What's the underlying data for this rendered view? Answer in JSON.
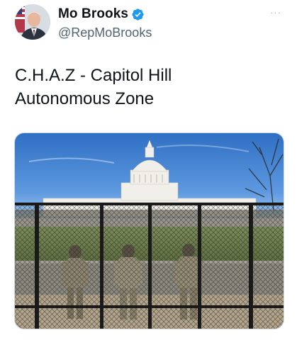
{
  "tweet": {
    "display_name": "Mo Brooks",
    "handle": "@RepMoBrooks",
    "more_label": "···",
    "text_lines": [
      "C.H.A.Z - Capitol Hill",
      "Autonomous Zone"
    ],
    "verified": true
  },
  "colors": {
    "verified_badge": "#1d9bf0",
    "name": "#0f1419",
    "handle": "#536471"
  },
  "icons": {
    "verified": "verified-badge-icon",
    "more": "more-options-icon"
  }
}
